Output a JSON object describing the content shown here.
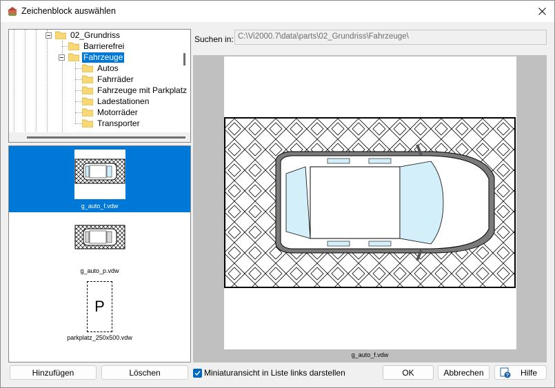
{
  "window": {
    "title": "Zeichenblock auswählen"
  },
  "tree": {
    "items": [
      {
        "label": "02_Grundriss"
      },
      {
        "label": "Barrierefrei"
      },
      {
        "label": "Fahrzeuge"
      },
      {
        "label": "Autos"
      },
      {
        "label": "Fahrräder"
      },
      {
        "label": "Fahrzeuge mit Parkplatz"
      },
      {
        "label": "Ladestationen"
      },
      {
        "label": "Motorräder"
      },
      {
        "label": "Transporter"
      }
    ]
  },
  "thumbnails": [
    {
      "filename": "g_auto_f.vdw"
    },
    {
      "filename": "g_auto_p.vdw"
    },
    {
      "filename": "parkplatz_250x500.vdw",
      "glyph": "P"
    }
  ],
  "search": {
    "label": "Suchen in:",
    "value": "C:\\Vi2000.7\\data\\parts\\02_Grundriss\\Fahrzeuge\\"
  },
  "preview": {
    "caption": "g_auto_f.vdw"
  },
  "footer": {
    "add_label": "Hinzufügen",
    "delete_label": "Löschen",
    "checkbox_label": "Miniaturansicht in Liste links darstellen",
    "checkbox_checked": true,
    "ok_label": "OK",
    "cancel_label": "Abbrechen",
    "help_label": "Hilfe"
  },
  "colors": {
    "selection": "#0078d7",
    "folder": "#f8d775",
    "checkbox": "#0067c0"
  }
}
